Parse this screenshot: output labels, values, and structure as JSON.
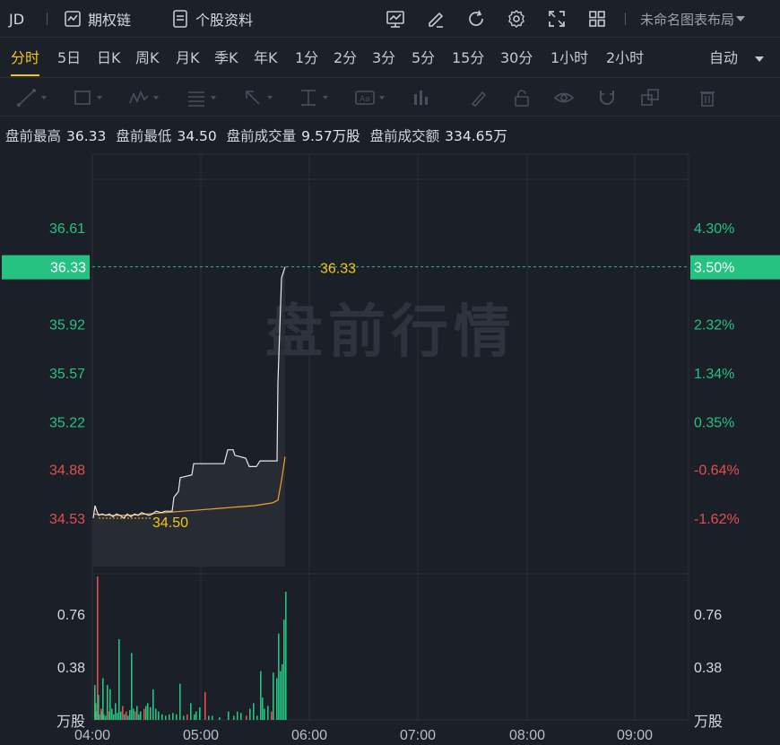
{
  "header": {
    "symbol": "JD",
    "options_chain": "期权链",
    "stock_info": "个股资料",
    "layout_name": "未命名图表布局"
  },
  "periods": {
    "items": [
      "分时",
      "5日",
      "日K",
      "周K",
      "月K",
      "季K",
      "年K",
      "1分",
      "2分",
      "3分",
      "5分",
      "15分",
      "30分",
      "1小时",
      "2小时"
    ],
    "active": "分时",
    "auto_label": "自动"
  },
  "tools": [
    "line-tool",
    "rectangle-tool",
    "pattern-tool",
    "fibonacci-tool",
    "arrow-tool",
    "measure-tool",
    "text-tool",
    "volume-tool",
    "brush-tool",
    "lock-tool",
    "visibility-tool",
    "magnet-tool",
    "clone-tool",
    "delete-tool"
  ],
  "info": {
    "high_label": "盘前最高",
    "high_value": "36.33",
    "low_label": "盘前最低",
    "low_value": "34.50",
    "volume_label": "盘前成交量",
    "volume_value": "9.57万股",
    "amount_label": "盘前成交额",
    "amount_value": "334.65万"
  },
  "watermark": "盘前行情",
  "colors": {
    "up": "#26c281",
    "down": "#e0504f",
    "price_line": "#e8e8e8",
    "avg_line": "#f0a030",
    "annotation": "#f5c518",
    "current_badge": "#26c281"
  },
  "chart_data": {
    "type": "line",
    "price_axis_left": [
      "36.61",
      "36.33",
      "35.92",
      "35.57",
      "35.22",
      "34.88",
      "34.53"
    ],
    "price_axis_right": [
      "4.30%",
      "3.50%",
      "2.32%",
      "1.34%",
      "0.35%",
      "-0.64%",
      "-1.62%"
    ],
    "up_tick_count": 5,
    "current_price": "36.33",
    "current_pct": "3.50%",
    "high_annotation": "36.33",
    "low_annotation": "34.50",
    "volume_axis_left": [
      "0.76",
      "0.38"
    ],
    "volume_axis_right": [
      "0.76",
      "0.38"
    ],
    "volume_unit": "万股",
    "x_ticks": [
      "04:00",
      "05:00",
      "06:00",
      "07:00",
      "08:00",
      "09:00"
    ],
    "ylim": [
      34.36,
      36.78
    ],
    "vol_max": 1.03,
    "price_series": {
      "name": "",
      "points": [
        [
          0,
          34.53
        ],
        [
          2,
          34.62
        ],
        [
          4,
          34.58
        ],
        [
          6,
          34.55
        ],
        [
          10,
          34.56
        ],
        [
          14,
          34.55
        ],
        [
          18,
          34.56
        ],
        [
          22,
          34.54
        ],
        [
          26,
          34.56
        ],
        [
          30,
          34.55
        ],
        [
          34,
          34.53
        ],
        [
          38,
          34.56
        ],
        [
          42,
          34.54
        ],
        [
          46,
          34.56
        ],
        [
          50,
          34.55
        ],
        [
          54,
          34.57
        ],
        [
          58,
          34.56
        ],
        [
          62,
          34.55
        ],
        [
          66,
          34.56
        ],
        [
          70,
          34.58
        ],
        [
          76,
          34.57
        ],
        [
          80,
          34.58
        ],
        [
          88,
          34.58
        ],
        [
          90,
          34.68
        ],
        [
          95,
          34.72
        ],
        [
          97,
          34.82
        ],
        [
          110,
          34.84
        ],
        [
          112,
          34.92
        ],
        [
          120,
          34.92
        ],
        [
          132,
          34.92
        ],
        [
          146,
          34.92
        ],
        [
          150,
          35.02
        ],
        [
          156,
          35.02
        ],
        [
          158,
          34.98
        ],
        [
          170,
          34.96
        ],
        [
          174,
          34.9
        ],
        [
          182,
          34.9
        ],
        [
          186,
          34.94
        ],
        [
          196,
          34.94
        ],
        [
          205,
          34.94
        ],
        [
          206,
          35.5
        ],
        [
          210,
          36.25
        ],
        [
          214,
          36.33
        ]
      ]
    },
    "avg_series": {
      "name": "",
      "points": [
        [
          0,
          34.56
        ],
        [
          20,
          34.55
        ],
        [
          40,
          34.55
        ],
        [
          60,
          34.56
        ],
        [
          80,
          34.57
        ],
        [
          100,
          34.58
        ],
        [
          120,
          34.59
        ],
        [
          140,
          34.6
        ],
        [
          160,
          34.61
        ],
        [
          180,
          34.62
        ],
        [
          200,
          34.64
        ],
        [
          206,
          34.66
        ],
        [
          210,
          34.8
        ],
        [
          214,
          34.97
        ]
      ]
    },
    "volume_bars": [
      {
        "x": 1,
        "v": 0.25,
        "c": "up"
      },
      {
        "x": 2,
        "v": 0.12,
        "c": "up"
      },
      {
        "x": 3,
        "v": 0.06,
        "c": "up"
      },
      {
        "x": 4,
        "v": 1.03,
        "c": "down"
      },
      {
        "x": 5,
        "v": 0.18,
        "c": "up"
      },
      {
        "x": 6,
        "v": 0.04,
        "c": "up"
      },
      {
        "x": 8,
        "v": 0.08,
        "c": "down"
      },
      {
        "x": 9,
        "v": 0.06,
        "c": "up"
      },
      {
        "x": 10,
        "v": 0.3,
        "c": "up"
      },
      {
        "x": 11,
        "v": 0.04,
        "c": "up"
      },
      {
        "x": 13,
        "v": 0.03,
        "c": "up"
      },
      {
        "x": 15,
        "v": 0.25,
        "c": "up"
      },
      {
        "x": 17,
        "v": 0.06,
        "c": "down"
      },
      {
        "x": 18,
        "v": 0.22,
        "c": "up"
      },
      {
        "x": 20,
        "v": 0.08,
        "c": "up"
      },
      {
        "x": 22,
        "v": 0.04,
        "c": "up"
      },
      {
        "x": 24,
        "v": 0.12,
        "c": "up"
      },
      {
        "x": 26,
        "v": 0.05,
        "c": "up"
      },
      {
        "x": 28,
        "v": 0.58,
        "c": "up"
      },
      {
        "x": 30,
        "v": 0.06,
        "c": "up"
      },
      {
        "x": 32,
        "v": 0.1,
        "c": "down"
      },
      {
        "x": 34,
        "v": 0.04,
        "c": "up"
      },
      {
        "x": 36,
        "v": 0.06,
        "c": "down"
      },
      {
        "x": 38,
        "v": 0.03,
        "c": "up"
      },
      {
        "x": 40,
        "v": 0.07,
        "c": "up"
      },
      {
        "x": 42,
        "v": 0.48,
        "c": "up"
      },
      {
        "x": 44,
        "v": 0.08,
        "c": "up"
      },
      {
        "x": 46,
        "v": 0.06,
        "c": "down"
      },
      {
        "x": 48,
        "v": 0.1,
        "c": "up"
      },
      {
        "x": 50,
        "v": 0.04,
        "c": "up"
      },
      {
        "x": 52,
        "v": 0.06,
        "c": "up"
      },
      {
        "x": 56,
        "v": 0.08,
        "c": "down"
      },
      {
        "x": 58,
        "v": 0.1,
        "c": "up"
      },
      {
        "x": 60,
        "v": 0.12,
        "c": "up"
      },
      {
        "x": 63,
        "v": 0.09,
        "c": "up"
      },
      {
        "x": 66,
        "v": 0.22,
        "c": "up"
      },
      {
        "x": 69,
        "v": 0.08,
        "c": "up"
      },
      {
        "x": 72,
        "v": 0.06,
        "c": "up"
      },
      {
        "x": 76,
        "v": 0.04,
        "c": "up"
      },
      {
        "x": 80,
        "v": 0.03,
        "c": "up"
      },
      {
        "x": 84,
        "v": 0.04,
        "c": "up"
      },
      {
        "x": 88,
        "v": 0.05,
        "c": "up"
      },
      {
        "x": 92,
        "v": 0.04,
        "c": "up"
      },
      {
        "x": 96,
        "v": 0.26,
        "c": "up"
      },
      {
        "x": 100,
        "v": 0.03,
        "c": "up"
      },
      {
        "x": 104,
        "v": 0.04,
        "c": "down"
      },
      {
        "x": 108,
        "v": 0.12,
        "c": "up"
      },
      {
        "x": 112,
        "v": 0.04,
        "c": "up"
      },
      {
        "x": 114,
        "v": 0.06,
        "c": "up"
      },
      {
        "x": 118,
        "v": 0.09,
        "c": "up"
      },
      {
        "x": 124,
        "v": 0.2,
        "c": "down"
      },
      {
        "x": 128,
        "v": 0.03,
        "c": "up"
      },
      {
        "x": 132,
        "v": 0.03,
        "c": "up"
      },
      {
        "x": 140,
        "v": 0.02,
        "c": "up"
      },
      {
        "x": 150,
        "v": 0.06,
        "c": "up"
      },
      {
        "x": 156,
        "v": 0.03,
        "c": "up"
      },
      {
        "x": 160,
        "v": 0.06,
        "c": "up"
      },
      {
        "x": 164,
        "v": 0.05,
        "c": "up"
      },
      {
        "x": 170,
        "v": 0.03,
        "c": "down"
      },
      {
        "x": 174,
        "v": 0.08,
        "c": "up"
      },
      {
        "x": 178,
        "v": 0.12,
        "c": "up"
      },
      {
        "x": 182,
        "v": 0.03,
        "c": "up"
      },
      {
        "x": 186,
        "v": 0.35,
        "c": "up"
      },
      {
        "x": 188,
        "v": 0.16,
        "c": "up"
      },
      {
        "x": 190,
        "v": 0.08,
        "c": "up"
      },
      {
        "x": 194,
        "v": 0.1,
        "c": "up"
      },
      {
        "x": 198,
        "v": 0.06,
        "c": "down"
      },
      {
        "x": 200,
        "v": 0.34,
        "c": "up"
      },
      {
        "x": 204,
        "v": 0.3,
        "c": "up"
      },
      {
        "x": 206,
        "v": 0.62,
        "c": "up"
      },
      {
        "x": 208,
        "v": 0.35,
        "c": "up"
      },
      {
        "x": 210,
        "v": 0.4,
        "c": "up"
      },
      {
        "x": 212,
        "v": 0.72,
        "c": "up"
      },
      {
        "x": 214,
        "v": 0.92,
        "c": "up"
      }
    ]
  }
}
